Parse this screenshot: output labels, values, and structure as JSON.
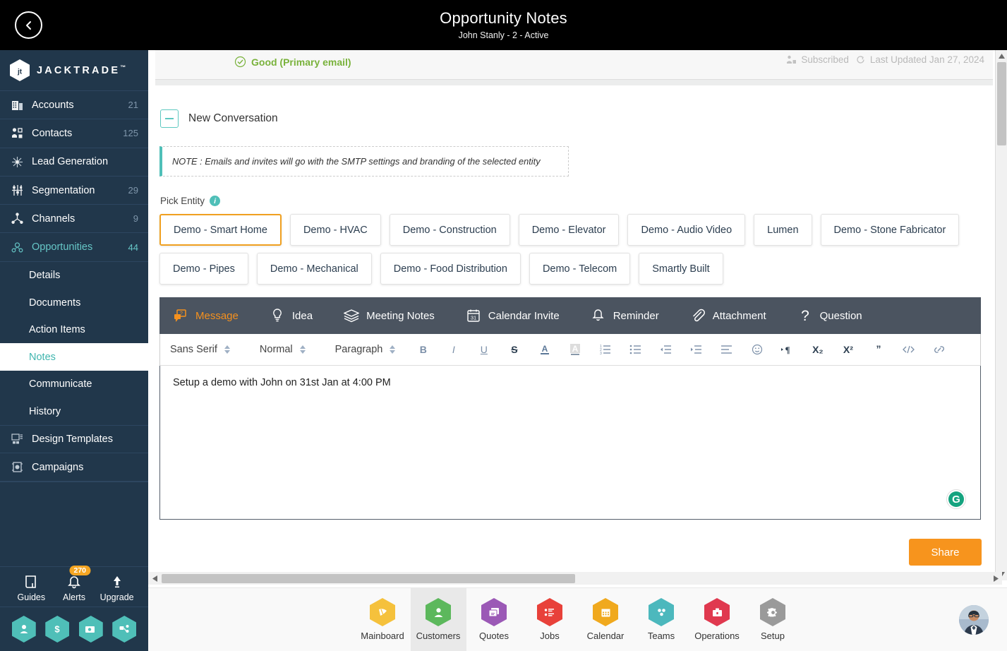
{
  "header": {
    "back_icon": "chevron-left-icon",
    "title": "Opportunity Notes",
    "subtitle": "John Stanly - 2 - Active"
  },
  "sidebar": {
    "brand": "JACKTRADE",
    "brand_tm": "™",
    "items": [
      {
        "label": "Accounts",
        "count": "21",
        "icon": "building-icon",
        "active": false
      },
      {
        "label": "Contacts",
        "count": "125",
        "icon": "contacts-icon",
        "active": false
      },
      {
        "label": "Lead Generation",
        "count": "",
        "icon": "lead-gen-icon",
        "active": false
      },
      {
        "label": "Segmentation",
        "count": "29",
        "icon": "segmentation-icon",
        "active": false
      },
      {
        "label": "Channels",
        "count": "9",
        "icon": "channels-icon",
        "active": false
      },
      {
        "label": "Opportunities",
        "count": "44",
        "icon": "opportunities-icon",
        "active": true
      }
    ],
    "sub_items": [
      {
        "label": "Details",
        "selected": false
      },
      {
        "label": "Documents",
        "selected": false
      },
      {
        "label": "Action Items",
        "selected": false
      },
      {
        "label": "Notes",
        "selected": true
      },
      {
        "label": "Communicate",
        "selected": false
      },
      {
        "label": "History",
        "selected": false
      }
    ],
    "items_lower": [
      {
        "label": "Design Templates",
        "count": "",
        "icon": "design-templates-icon",
        "active": false
      },
      {
        "label": "Campaigns",
        "count": "",
        "icon": "campaigns-icon",
        "active": false
      }
    ],
    "utils": [
      {
        "label": "Guides",
        "icon": "book-icon",
        "badge": ""
      },
      {
        "label": "Alerts",
        "icon": "bell-icon",
        "badge": "270"
      },
      {
        "label": "Upgrade",
        "icon": "arrow-up-icon",
        "badge": ""
      }
    ],
    "hex_shortcuts": [
      {
        "icon": "person-icon"
      },
      {
        "icon": "dollar-icon"
      },
      {
        "icon": "payment-icon"
      },
      {
        "icon": "workflow-icon"
      }
    ],
    "accent_color": "#4fbfb8",
    "background_color": "#21374b"
  },
  "status_strip": {
    "good_label": "Good (Primary email)",
    "good_icon": "check-circle-icon",
    "subscribed_label": "Subscribed",
    "subscribed_icon": "subscribed-icon",
    "last_updated_label": "Last Updated Jan 27, 2024",
    "last_updated_icon": "refresh-icon",
    "good_color": "#79b23b"
  },
  "conversation": {
    "collapse_icon": "minus-box-icon",
    "title": "New Conversation",
    "note": "NOTE : Emails and invites will go with the SMTP settings and branding of the selected entity"
  },
  "pick_entity": {
    "label": "Pick Entity",
    "info_icon": "info-icon",
    "entities": [
      {
        "label": "Demo - Smart Home",
        "selected": true
      },
      {
        "label": "Demo - HVAC",
        "selected": false
      },
      {
        "label": "Demo - Construction",
        "selected": false
      },
      {
        "label": "Demo - Elevator",
        "selected": false
      },
      {
        "label": "Demo - Audio Video",
        "selected": false
      },
      {
        "label": "Lumen",
        "selected": false
      },
      {
        "label": "Demo - Stone Fabricator",
        "selected": false
      },
      {
        "label": "Demo - Pipes",
        "selected": false
      },
      {
        "label": "Demo - Mechanical",
        "selected": false
      },
      {
        "label": "Demo - Food Distribution",
        "selected": false
      },
      {
        "label": "Demo - Telecom",
        "selected": false
      },
      {
        "label": "Smartly Built",
        "selected": false
      }
    ],
    "selected_border_color": "#f0a020"
  },
  "editor": {
    "tabs": [
      {
        "label": "Message",
        "icon": "message-icon",
        "active": true
      },
      {
        "label": "Idea",
        "icon": "lightbulb-icon",
        "active": false
      },
      {
        "label": "Meeting Notes",
        "icon": "layers-icon",
        "active": false
      },
      {
        "label": "Calendar Invite",
        "icon": "calendar-31-icon",
        "active": false
      },
      {
        "label": "Reminder",
        "icon": "bell-icon",
        "active": false
      },
      {
        "label": "Attachment",
        "icon": "paperclip-icon",
        "active": false
      },
      {
        "label": "Question",
        "icon": "question-mark-icon",
        "active": false
      }
    ],
    "tab_active_color": "#f5911e",
    "tabbar_bg": "#4b5460",
    "toolbar": {
      "font_family": "Sans Serif",
      "font_size": "Normal",
      "block_format": "Paragraph",
      "buttons": [
        {
          "label": "B",
          "name": "bold-icon"
        },
        {
          "label": "I",
          "name": "italic-icon"
        },
        {
          "label": "U",
          "name": "underline-icon"
        },
        {
          "label": "S",
          "name": "strikethrough-icon"
        },
        {
          "label": "A",
          "name": "text-color-icon"
        },
        {
          "label": "A",
          "name": "background-color-icon"
        },
        {
          "label": "",
          "name": "ordered-list-icon"
        },
        {
          "label": "",
          "name": "bullet-list-icon"
        },
        {
          "label": "",
          "name": "outdent-icon"
        },
        {
          "label": "",
          "name": "indent-icon"
        },
        {
          "label": "",
          "name": "align-icon"
        },
        {
          "label": "",
          "name": "emoji-icon"
        },
        {
          "label": "",
          "name": "text-direction-icon"
        },
        {
          "label": "X₂",
          "name": "subscript-icon"
        },
        {
          "label": "X²",
          "name": "superscript-icon"
        },
        {
          "label": "",
          "name": "blockquote-icon"
        },
        {
          "label": "",
          "name": "code-block-icon"
        },
        {
          "label": "",
          "name": "link-icon"
        }
      ]
    },
    "content": "Setup a demo with John on 31st Jan at 4:00 PM",
    "grammarly_icon": "grammarly-icon",
    "share_label": "Share",
    "share_color": "#f7941d"
  },
  "bottom_nav": {
    "items": [
      {
        "label": "Mainboard",
        "icon": "mainboard-icon",
        "color": "#f5c13c",
        "active": false
      },
      {
        "label": "Customers",
        "icon": "customers-icon",
        "color": "#5cb85c",
        "active": true
      },
      {
        "label": "Quotes",
        "icon": "quotes-icon",
        "color": "#9b59b6",
        "active": false
      },
      {
        "label": "Jobs",
        "icon": "jobs-icon",
        "color": "#e8413a",
        "active": false
      },
      {
        "label": "Calendar",
        "icon": "calendar-icon",
        "color": "#f0a91e",
        "active": false
      },
      {
        "label": "Teams",
        "icon": "teams-icon",
        "color": "#4cb8bd",
        "active": false
      },
      {
        "label": "Operations",
        "icon": "operations-icon",
        "color": "#e0394f",
        "active": false
      },
      {
        "label": "Setup",
        "icon": "gear-icon",
        "color": "#9a9a9a",
        "active": false
      }
    ],
    "avatar": "user-avatar"
  }
}
